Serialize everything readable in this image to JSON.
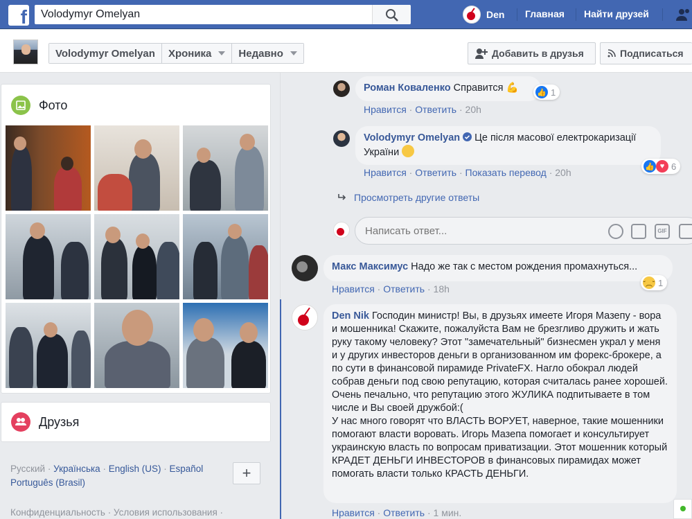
{
  "colors": {
    "brand": "#4267b2",
    "link": "#385898",
    "muted": "#90949c"
  },
  "topbar": {
    "search_value": "Volodymyr Omelyan",
    "user_name": "Den",
    "nav": [
      "Главная",
      "Найти друзей"
    ]
  },
  "subheader": {
    "crumbs": [
      "Volodymyr Omelyan",
      "Хроника",
      "Недавно"
    ],
    "add_friend": "Добавить в друзья",
    "subscribe": "Подписаться"
  },
  "left": {
    "photos_title": "Фото",
    "friends_title": "Друзья",
    "languages": [
      "Русский",
      "Українська",
      "English (US)",
      "Español",
      "Português (Brasil)"
    ],
    "plus": "+",
    "footer": "Конфиденциальность · Условия использования ·"
  },
  "comments": {
    "c1": {
      "author": "Роман Коваленко",
      "text": "Справится",
      "emoji": "💪",
      "actions": [
        "Нравится",
        "Ответить"
      ],
      "time": "20h",
      "reaction_count": "1"
    },
    "c2": {
      "author": "Volodymyr Omelyan",
      "text": "Це після масової електрокаризації України",
      "actions": [
        "Нравится",
        "Ответить",
        "Показать перевод"
      ],
      "time": "20h",
      "reaction_count": "6"
    },
    "more_replies": "Просмотреть другие ответы",
    "reply_placeholder": "Написать ответ...",
    "c3": {
      "author": "Макс Максимус",
      "text": "Надо же так с местом рождения промахнуться...",
      "actions": [
        "Нравится",
        "Ответить"
      ],
      "time": "18h",
      "reaction_count": "1"
    },
    "c4": {
      "author": "Den Nik",
      "text": "Господин министр! Вы, в друзьях имеете Игоря Мазепу - вора и мошенника! Скажите, пожалуйста Вам не брезгливо дружить и жать руку такому человеку? Этот \"замечательный\" бизнесмен украл у меня и у других инвесторов деньги в организованном им форекс-брокере, а по сути в финансовой пирамиде PrivateFX. Нагло обокрал людей собрав деньги под свою репутацию, которая считалась ранее хорошей.",
      "text2": "Очень печально, что репутацию этого ЖУЛИКА подпитываете в том числе и Вы своей дружбой:(",
      "text3": "У нас много говорят что ВЛАСТЬ ВОРУЕТ, наверное, такие мошенники помогают власти воровать. Игорь Мазепа помогает и консультирует украинскую власть по вопросам приватизации. Этот мошенник который КРАДЕТ ДЕНЬГИ ИНВЕСТОРОВ в финансовых пирамидах может помогать власти только КРАСТЬ ДЕНЬГИ.",
      "actions": [
        "Нравится",
        "Ответить"
      ],
      "time": "1 мин."
    }
  }
}
